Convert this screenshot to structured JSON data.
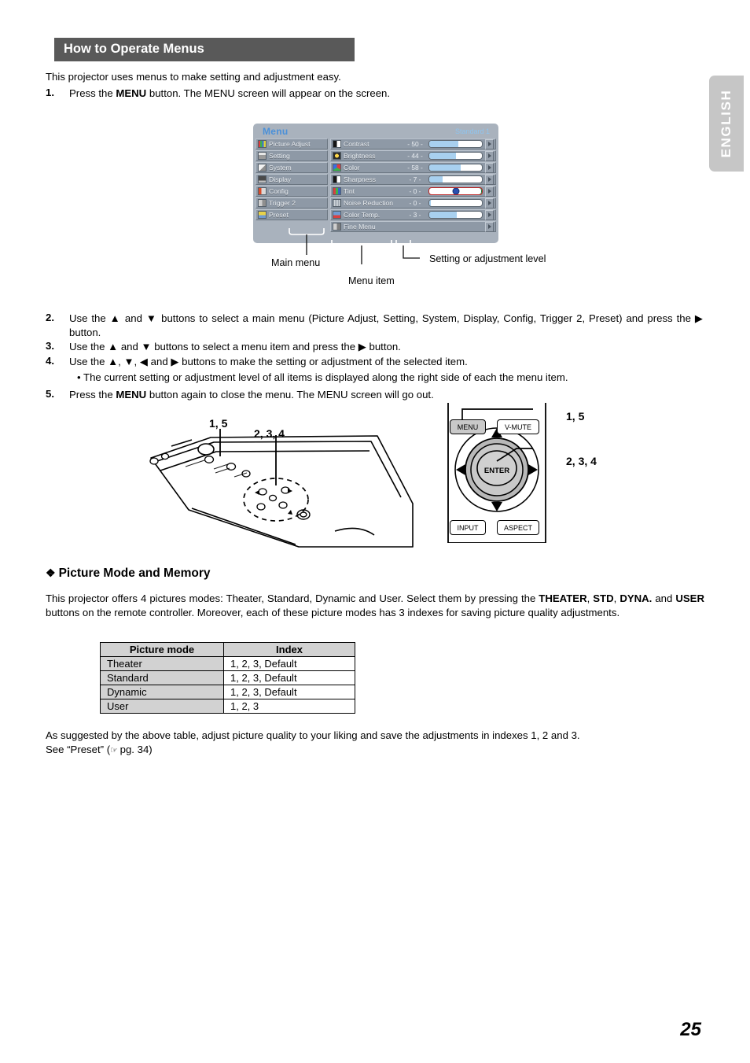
{
  "language_tab": "ENGLISH",
  "page_number": "25",
  "header": {
    "title": "How to Operate Menus"
  },
  "intro": "This projector uses menus to make setting and adjustment easy.",
  "steps": [
    {
      "num": "1.",
      "text_parts": [
        "Press the ",
        "MENU",
        " button. The MENU screen will appear on the screen."
      ]
    },
    {
      "num": "2.",
      "text": "Use the ▲ and ▼ buttons to select a main menu (Picture Adjust, Setting, System, Display, Config, Trigger 2, Preset) and press the ▶ button."
    },
    {
      "num": "3.",
      "text": "Use the ▲ and ▼ buttons to select a menu item and press the ▶ button."
    },
    {
      "num": "4.",
      "text": "Use the ▲, ▼, ◀ and ▶ buttons to make the setting or adjustment of the selected item."
    },
    {
      "num": "",
      "text": "• The current setting or adjustment level of all items is displayed along the right side of each the menu item."
    },
    {
      "num": "5.",
      "text_parts": [
        "Press the ",
        "MENU",
        " button again to close the menu. The MENU screen will go out."
      ]
    }
  ],
  "osd": {
    "title": "Menu",
    "preset_label": "Standard 1",
    "main_menu": [
      {
        "label": "Picture Adjust",
        "icon": "picture-adjust-icon",
        "selected": true
      },
      {
        "label": "Setting",
        "icon": "setting-icon",
        "selected": false
      },
      {
        "label": "System",
        "icon": "system-icon",
        "selected": false
      },
      {
        "label": "Display",
        "icon": "display-icon",
        "selected": false
      },
      {
        "label": "Config",
        "icon": "config-icon",
        "selected": false
      },
      {
        "label": "Trigger 2",
        "icon": "trigger-icon",
        "selected": false
      },
      {
        "label": "Preset",
        "icon": "preset-icon",
        "selected": false
      }
    ],
    "menu_items": [
      {
        "label": "Contrast",
        "value": "- 50 -",
        "fill": 55,
        "icon": "contrast-icon",
        "type": "slider"
      },
      {
        "label": "Brightness",
        "value": "- 44 -",
        "fill": 50,
        "icon": "brightness-icon",
        "type": "slider"
      },
      {
        "label": "Color",
        "value": "- 58 -",
        "fill": 60,
        "icon": "color-icon",
        "type": "slider"
      },
      {
        "label": "Sharpness",
        "value": "- 7 -",
        "fill": 25,
        "icon": "sharpness-icon",
        "type": "slider"
      },
      {
        "label": "Tint",
        "value": "- 0 -",
        "fill": 0,
        "icon": "tint-icon",
        "type": "tint"
      },
      {
        "label": "Noise Reduction",
        "value": "- 0 -",
        "fill": 3,
        "icon": "noise-reduction-icon",
        "type": "slider"
      },
      {
        "label": "Color Temp.",
        "value": "- 3 -",
        "fill": 52,
        "icon": "color-temp-icon",
        "type": "slider"
      },
      {
        "label": "Fine Menu",
        "value": "",
        "fill": 0,
        "icon": "fine-menu-icon",
        "type": "none"
      }
    ],
    "callouts": {
      "main_menu": "Main menu",
      "menu_item": "Menu item",
      "level": "Setting or adjustment level"
    }
  },
  "diagrams": {
    "projector": {
      "callout_a": "1, 5",
      "callout_b": "2, 3, 4"
    },
    "remote": {
      "callout_a": "1, 5",
      "callout_b": "2, 3, 4",
      "buttons": {
        "menu": "MENU",
        "vmute": "V-MUTE",
        "enter": "ENTER",
        "input": "INPUT",
        "aspect": "ASPECT"
      }
    }
  },
  "picture_mode": {
    "heading": "Picture Mode and Memory",
    "heading_bullet": "❖",
    "paragraph_parts": [
      "This projector offers 4 pictures modes: Theater, Standard, Dynamic and User. Select them by pressing the ",
      "THEATER",
      ", ",
      "STD",
      ", ",
      "DYNA.",
      " and ",
      "USER",
      " buttons on the remote controller. Moreover, each of these picture modes has 3 indexes for saving picture quality adjustments."
    ],
    "table": {
      "headers": [
        "Picture mode",
        "Index"
      ],
      "rows": [
        [
          "Theater",
          "1, 2, 3, Default"
        ],
        [
          "Standard",
          "1, 2, 3, Default"
        ],
        [
          "Dynamic",
          "1, 2, 3, Default"
        ],
        [
          "User",
          "1, 2, 3"
        ]
      ]
    },
    "footer_line1": "As suggested by the above table, adjust picture quality to your liking and save the adjustments in indexes 1, 2 and 3.",
    "footer_line2_pre": "See “Preset” (",
    "footer_line2_icon": "☞",
    "footer_line2_post": " pg. 34)"
  },
  "colors": {
    "heading_bar": "#595959",
    "osd_panel": "#a9b2bd",
    "osd_row": "#8e99a6",
    "osd_title": "#4a90d9",
    "slider_fill": "#a8d0ef",
    "table_gray": "#d2d2d2"
  }
}
